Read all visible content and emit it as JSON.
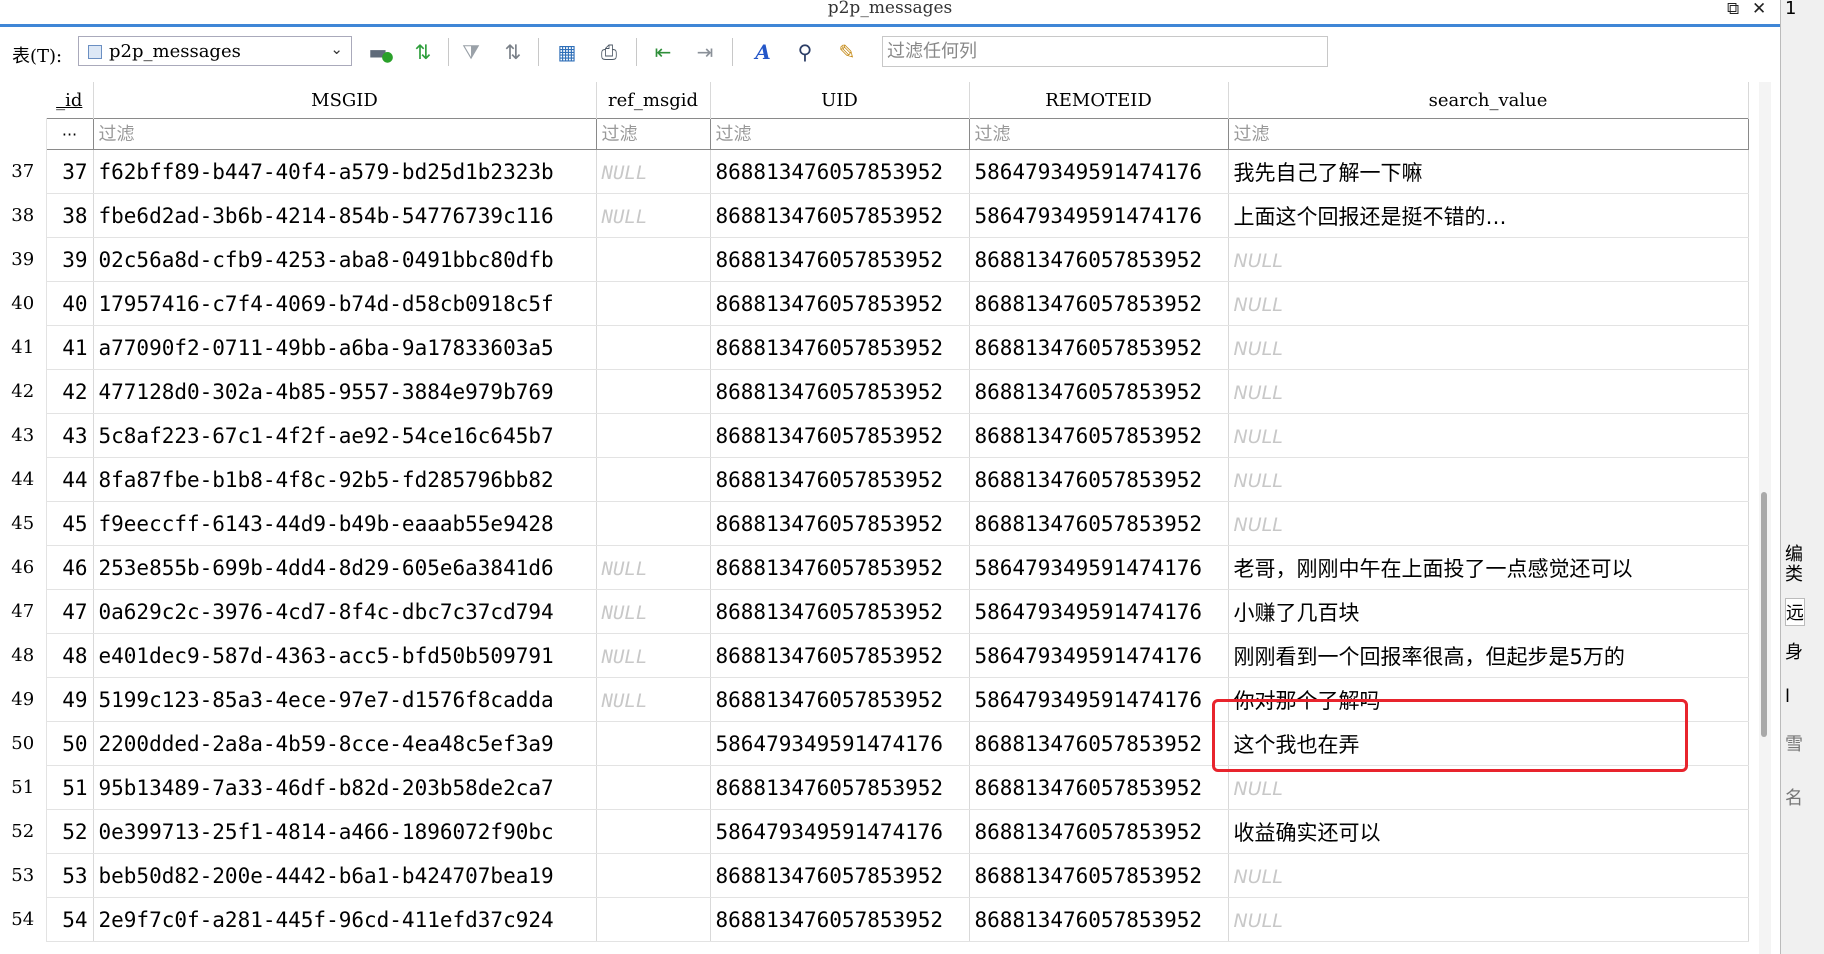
{
  "window": {
    "title": "p2p_messages",
    "restore_icon": "restore-icon",
    "close_icon": "close-icon"
  },
  "toolbar": {
    "table_label": "表(T):",
    "table_value": "p2p_messages",
    "filter_placeholder": "过滤任何列",
    "icons": [
      "add-record-icon",
      "refresh-icon",
      "clear-filter-icon",
      "sort-icon",
      "save-icon",
      "print-icon",
      "import-icon",
      "export-icon",
      "font-icon",
      "find-icon",
      "edit-icon"
    ]
  },
  "table": {
    "columns": [
      "_id",
      "MSGID",
      "ref_msgid",
      "UID",
      "REMOTEID",
      "search_value"
    ],
    "filter_placeholder": "过滤",
    "dots": "···",
    "rows": [
      {
        "rn": "37",
        "id": "37",
        "msgid": "f62bff89-b447-40f4-a579-bd25d1b2323b",
        "ref": "NULL",
        "uid": "868813476057853952",
        "remote": "586479349591474176",
        "search": "我先自己了解一下嘛"
      },
      {
        "rn": "38",
        "id": "38",
        "msgid": "fbe6d2ad-3b6b-4214-854b-54776739c116",
        "ref": "NULL",
        "uid": "868813476057853952",
        "remote": "586479349591474176",
        "search": "上面这个回报还是挺不错的…"
      },
      {
        "rn": "39",
        "id": "39",
        "msgid": "02c56a8d-cfb9-4253-aba8-0491bbc80dfb",
        "ref": "",
        "uid": "868813476057853952",
        "remote": "868813476057853952",
        "search": "NULL"
      },
      {
        "rn": "40",
        "id": "40",
        "msgid": "17957416-c7f4-4069-b74d-d58cb0918c5f",
        "ref": "",
        "uid": "868813476057853952",
        "remote": "868813476057853952",
        "search": "NULL"
      },
      {
        "rn": "41",
        "id": "41",
        "msgid": "a77090f2-0711-49bb-a6ba-9a17833603a5",
        "ref": "",
        "uid": "868813476057853952",
        "remote": "868813476057853952",
        "search": "NULL"
      },
      {
        "rn": "42",
        "id": "42",
        "msgid": "477128d0-302a-4b85-9557-3884e979b769",
        "ref": "",
        "uid": "868813476057853952",
        "remote": "868813476057853952",
        "search": "NULL"
      },
      {
        "rn": "43",
        "id": "43",
        "msgid": "5c8af223-67c1-4f2f-ae92-54ce16c645b7",
        "ref": "",
        "uid": "868813476057853952",
        "remote": "868813476057853952",
        "search": "NULL"
      },
      {
        "rn": "44",
        "id": "44",
        "msgid": "8fa87fbe-b1b8-4f8c-92b5-fd285796bb82",
        "ref": "",
        "uid": "868813476057853952",
        "remote": "868813476057853952",
        "search": "NULL"
      },
      {
        "rn": "45",
        "id": "45",
        "msgid": "f9eeccff-6143-44d9-b49b-eaaab55e9428",
        "ref": "",
        "uid": "868813476057853952",
        "remote": "868813476057853952",
        "search": "NULL"
      },
      {
        "rn": "46",
        "id": "46",
        "msgid": "253e855b-699b-4dd4-8d29-605e6a3841d6",
        "ref": "NULL",
        "uid": "868813476057853952",
        "remote": "586479349591474176",
        "search": "老哥，刚刚中午在上面投了一点感觉还可以"
      },
      {
        "rn": "47",
        "id": "47",
        "msgid": "0a629c2c-3976-4cd7-8f4c-dbc7c37cd794",
        "ref": "NULL",
        "uid": "868813476057853952",
        "remote": "586479349591474176",
        "search": "小赚了几百块"
      },
      {
        "rn": "48",
        "id": "48",
        "msgid": "e401dec9-587d-4363-acc5-bfd50b509791",
        "ref": "NULL",
        "uid": "868813476057853952",
        "remote": "586479349591474176",
        "search": "刚刚看到一个回报率很高，但起步是5万的"
      },
      {
        "rn": "49",
        "id": "49",
        "msgid": "5199c123-85a3-4ece-97e7-d1576f8cadda",
        "ref": "NULL",
        "uid": "868813476057853952",
        "remote": "586479349591474176",
        "search": "你对那个了解吗"
      },
      {
        "rn": "50",
        "id": "50",
        "msgid": "2200dded-2a8a-4b59-8cce-4ea48c5ef3a9",
        "ref": "",
        "uid": "586479349591474176",
        "remote": "868813476057853952",
        "search": "这个我也在弄"
      },
      {
        "rn": "51",
        "id": "51",
        "msgid": "95b13489-7a33-46df-b82d-203b58de2ca7",
        "ref": "",
        "uid": "868813476057853952",
        "remote": "868813476057853952",
        "search": "NULL"
      },
      {
        "rn": "52",
        "id": "52",
        "msgid": "0e399713-25f1-4814-a466-1896072f90bc",
        "ref": "",
        "uid": "586479349591474176",
        "remote": "868813476057853952",
        "search": "收益确实还可以"
      },
      {
        "rn": "53",
        "id": "53",
        "msgid": "beb50d82-200e-4442-b6a1-b424707bea19",
        "ref": "",
        "uid": "868813476057853952",
        "remote": "868813476057853952",
        "search": "NULL"
      },
      {
        "rn": "54",
        "id": "54",
        "msgid": "2e9f7c0f-a281-445f-96cd-411efd37c924",
        "ref": "",
        "uid": "868813476057853952",
        "remote": "868813476057853952",
        "search": "NULL"
      }
    ]
  },
  "right_panel": {
    "chars": [
      "1",
      "编",
      "类",
      "远",
      "身",
      "l",
      "雪",
      "名"
    ]
  }
}
